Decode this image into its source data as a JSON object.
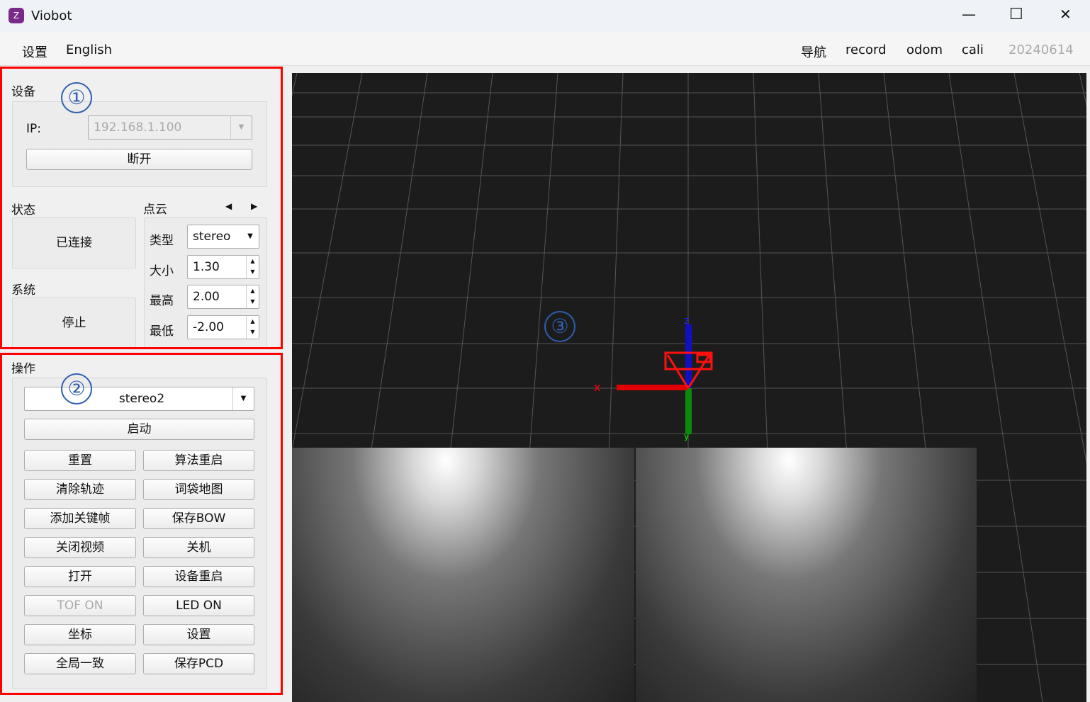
{
  "window": {
    "title": "Viobot",
    "minimize": "—",
    "maximize": "☐",
    "close": "✕"
  },
  "toolbar": {
    "left": [
      "设置",
      "English"
    ],
    "right": [
      "导航",
      "record",
      "odom",
      "cali"
    ],
    "version": "20240614"
  },
  "device": {
    "title": "设备",
    "ip_label": "IP:",
    "ip_value": "192.168.1.100",
    "disconnect": "断开"
  },
  "status": {
    "title": "状态",
    "value": "已连接"
  },
  "system": {
    "title": "系统",
    "value": "停止"
  },
  "pointcloud": {
    "title": "点云",
    "prev": "◀",
    "next": "▶",
    "type_label": "类型",
    "type_value": "stereo",
    "size_label": "大小",
    "size_value": "1.30",
    "max_label": "最高",
    "max_value": "2.00",
    "min_label": "最低",
    "min_value": "-2.00"
  },
  "ops": {
    "title": "操作",
    "mode": "stereo2",
    "start": "启动",
    "buttons": [
      [
        "重置",
        "算法重启"
      ],
      [
        "清除轨迹",
        "词袋地图"
      ],
      [
        "添加关键帧",
        "保存BOW"
      ],
      [
        "关闭视频",
        "关机"
      ],
      [
        "打开",
        "设备重启"
      ],
      [
        "TOF ON",
        "LED ON"
      ],
      [
        "坐标",
        "设置"
      ],
      [
        "全局一致",
        "保存PCD"
      ]
    ]
  },
  "annotations": [
    "①",
    "②",
    "③"
  ],
  "axes": {
    "x": "x",
    "y": "y",
    "z": "z"
  },
  "colors": {
    "x": "#ff0000",
    "y": "#00a000",
    "z": "#1010c0",
    "highlight": "#ff0000",
    "annotation": "#2f5fb0"
  }
}
